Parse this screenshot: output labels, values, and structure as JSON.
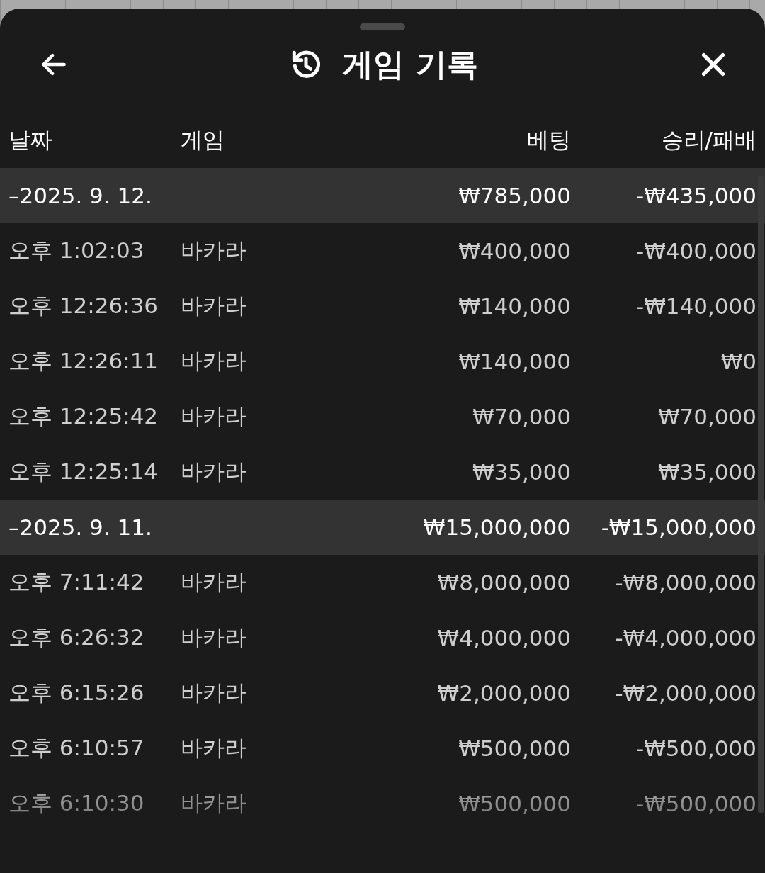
{
  "header": {
    "title": "게임 기록"
  },
  "columns": [
    "날짜",
    "게임",
    "베팅",
    "승리/패배"
  ],
  "groups": [
    {
      "date": "–2025. 9. 12.",
      "bet": "₩785,000",
      "result": "-₩435,000",
      "rows": [
        {
          "time": "오후 1:02:03",
          "game": "바카라",
          "bet": "₩400,000",
          "result": "-₩400,000"
        },
        {
          "time": "오후 12:26:36",
          "game": "바카라",
          "bet": "₩140,000",
          "result": "-₩140,000"
        },
        {
          "time": "오후 12:26:11",
          "game": "바카라",
          "bet": "₩140,000",
          "result": "₩0"
        },
        {
          "time": "오후 12:25:42",
          "game": "바카라",
          "bet": "₩70,000",
          "result": "₩70,000"
        },
        {
          "time": "오후 12:25:14",
          "game": "바카라",
          "bet": "₩35,000",
          "result": "₩35,000"
        }
      ]
    },
    {
      "date": "–2025. 9. 11.",
      "bet": "₩15,000,000",
      "result": "-₩15,000,000",
      "rows": [
        {
          "time": "오후 7:11:42",
          "game": "바카라",
          "bet": "₩8,000,000",
          "result": "-₩8,000,000"
        },
        {
          "time": "오후 6:26:32",
          "game": "바카라",
          "bet": "₩4,000,000",
          "result": "-₩4,000,000"
        },
        {
          "time": "오후 6:15:26",
          "game": "바카라",
          "bet": "₩2,000,000",
          "result": "-₩2,000,000"
        },
        {
          "time": "오후 6:10:57",
          "game": "바카라",
          "bet": "₩500,000",
          "result": "-₩500,000"
        },
        {
          "time": "오후 6:10:30",
          "game": "바카라",
          "bet": "₩500,000",
          "result": "-₩500,000"
        }
      ]
    }
  ]
}
